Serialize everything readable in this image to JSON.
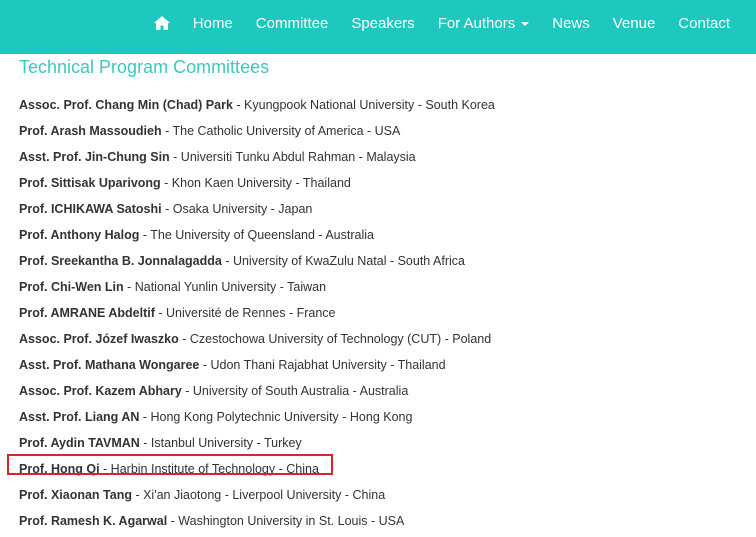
{
  "nav": {
    "home_icon": "home-icon",
    "items": [
      {
        "label": "Home"
      },
      {
        "label": "Committee"
      },
      {
        "label": "Speakers"
      },
      {
        "label": "For Authors"
      },
      {
        "label": "News"
      },
      {
        "label": "Venue"
      },
      {
        "label": "Contact"
      }
    ]
  },
  "page": {
    "title": "Technical Program Committees"
  },
  "members": [
    {
      "name": "Assoc. Prof. Chang Min (Chad) Park",
      "affiliation": " - Kyungpook National University - South Korea"
    },
    {
      "name": "Prof. Arash Massoudieh",
      "affiliation": " - The Catholic University of America - USA"
    },
    {
      "name": "Asst. Prof. Jin-Chung Sin",
      "affiliation": " - Universiti Tunku Abdul Rahman - Malaysia"
    },
    {
      "name": "Prof. Sittisak Uparivong",
      "affiliation": " - Khon Kaen University - Thailand"
    },
    {
      "name": "Prof. ICHIKAWA Satoshi",
      "affiliation": " - Osaka University - Japan"
    },
    {
      "name": "Prof. Anthony Halog",
      "affiliation": " - The University of Queensland - Australia"
    },
    {
      "name": "Prof. Sreekantha B. Jonnalagadda",
      "affiliation": " - University of KwaZulu Natal - South Africa"
    },
    {
      "name": "Prof. Chi-Wen Lin",
      "affiliation": " - National Yunlin University - Taiwan"
    },
    {
      "name": "Prof. AMRANE Abdeltif",
      "affiliation": " - Université de Rennes - France"
    },
    {
      "name": "Assoc. Prof. Józef Iwaszko",
      "affiliation": " - Czestochowa University of Technology (CUT) - Poland"
    },
    {
      "name": "Asst. Prof. Mathana Wongaree",
      "affiliation": " - Udon Thani Rajabhat University - Thailand"
    },
    {
      "name": "Assoc. Prof. Kazem Abhary",
      "affiliation": " - University of South Australia - Australia"
    },
    {
      "name": "Asst. Prof. Liang AN",
      "affiliation": " - Hong Kong Polytechnic University - Hong Kong"
    },
    {
      "name": "Prof. Aydin TAVMAN",
      "affiliation": " - Istanbul University - Turkey"
    },
    {
      "name": "Prof. Hong Qi",
      "affiliation": " - Harbin Institute of Technology - China"
    },
    {
      "name": "Prof. Xiaonan Tang",
      "affiliation": " - Xi'an Jiaotong - Liverpool University - China"
    },
    {
      "name": "Prof. Ramesh K. Agarwal",
      "affiliation": " - Washington University in St. Louis - USA"
    }
  ],
  "colors": {
    "navbar": "#1fc8be",
    "title": "#3cc8c0",
    "highlight": "#d9242f"
  }
}
